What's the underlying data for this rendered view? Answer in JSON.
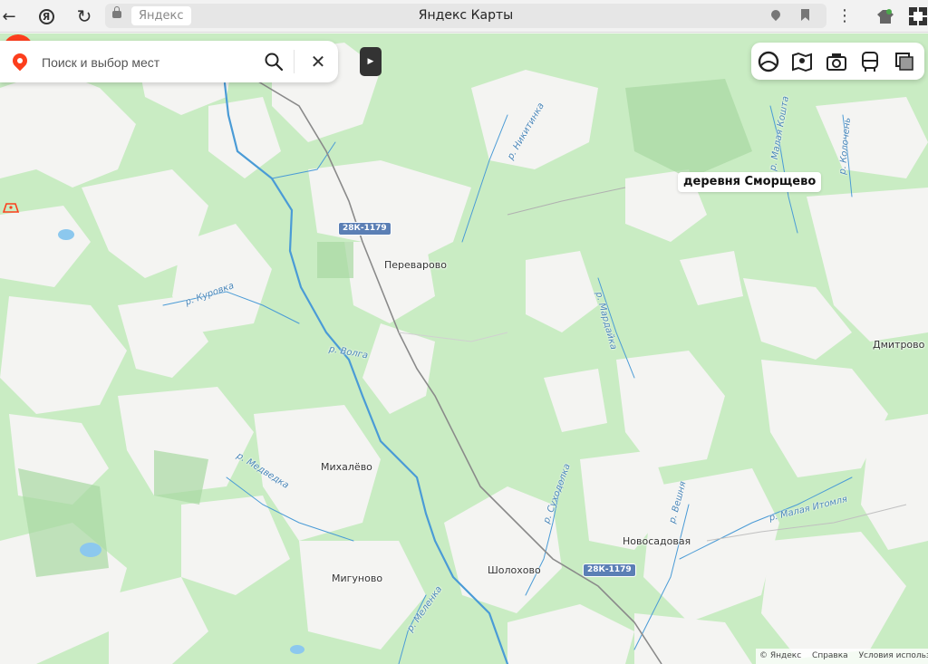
{
  "browser": {
    "site_chip": "Яндекс",
    "page_title": "Яндекс Карты",
    "yandex_letter": "Я",
    "menu_glyph": "⋮"
  },
  "search": {
    "placeholder": "Поиск и выбор мест",
    "clear_glyph": "✕",
    "collapse_glyph": "▶"
  },
  "toolbar": {
    "icons": [
      "panorama-icon",
      "layers-map-icon",
      "camera-icon",
      "transit-icon",
      "map-type-icon"
    ]
  },
  "place": {
    "name": "деревня Сморщево"
  },
  "map_labels": {
    "settlements": [
      "Переварово",
      "Дмитрово",
      "Михалёво",
      "Новосадовая",
      "Шолохово",
      "Мигуново"
    ],
    "rivers": [
      "р. Никитинка",
      "р. Малая Кошта",
      "р. Колочень",
      "р. Куровка",
      "р. Волга",
      "р. Мардайка",
      "р. Медведка",
      "р. Суходолка",
      "р. Вешня",
      "р. Малая Итомля",
      "р. Меленка"
    ],
    "road_signs": [
      "28К-1179",
      "28К-1179"
    ]
  },
  "footer": {
    "copyright": "© Яндекс",
    "help": "Справка",
    "terms": "Условия использования"
  },
  "colors": {
    "forest": "#c9ecc3",
    "field": "#f4f4f2",
    "water": "#4a9bd6",
    "road": "#8a8a8a",
    "marker": "#fc3f1d"
  }
}
